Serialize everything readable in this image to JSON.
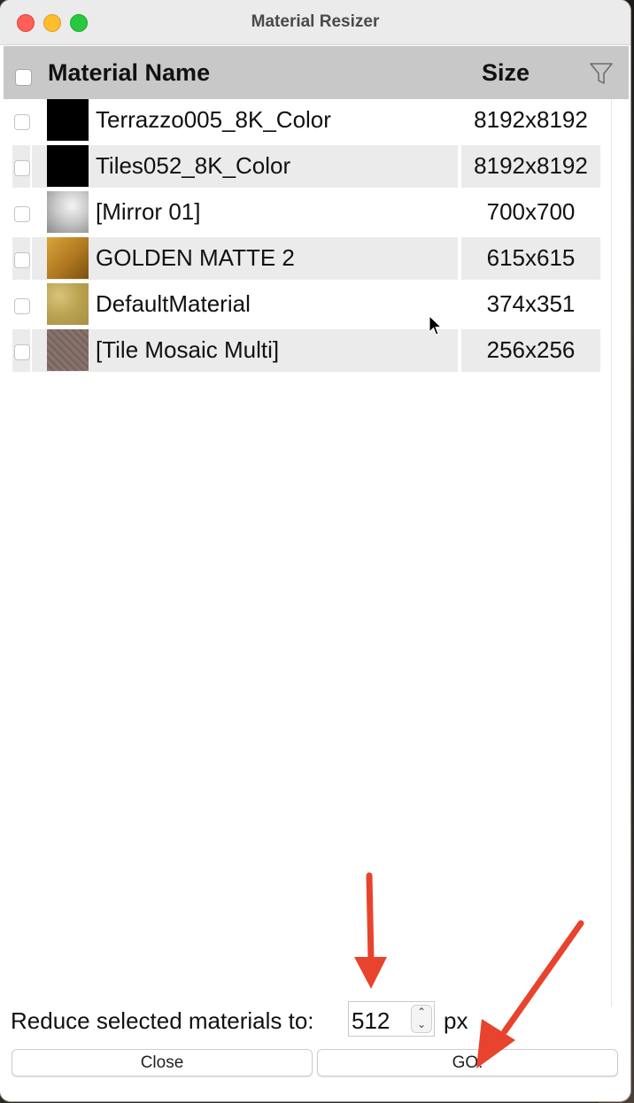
{
  "window": {
    "title": "Material Resizer"
  },
  "table": {
    "headers": {
      "name": "Material Name",
      "size": "Size"
    },
    "rows": [
      {
        "name": "Terrazzo005_8K_Color",
        "size": "8192x8192",
        "thumb_color": "#000000"
      },
      {
        "name": "Tiles052_8K_Color",
        "size": "8192x8192",
        "thumb_color": "#000000"
      },
      {
        "name": "[Mirror 01]",
        "size": "700x700",
        "thumb_color": "#b5b5b5"
      },
      {
        "name": "GOLDEN MATTE 2",
        "size": "615x615",
        "thumb_color": "#c08a2a"
      },
      {
        "name": "DefaultMaterial",
        "size": "374x351",
        "thumb_color": "#c6b060"
      },
      {
        "name": "[Tile Mosaic Multi]",
        "size": "256x256",
        "thumb_color": "#7d6a63"
      }
    ]
  },
  "footer": {
    "label": "Reduce selected materials to:",
    "value": "512",
    "unit": "px",
    "close_label": "Close",
    "go_label": "GO!"
  },
  "colors": {
    "header_bg": "#c8c8c8",
    "alt_row_bg": "#ebebeb",
    "annotation_arrow": "#e8432c"
  },
  "icons": [
    "filter-icon",
    "chevron-up-icon",
    "chevron-down-icon",
    "mouse-pointer-icon"
  ]
}
